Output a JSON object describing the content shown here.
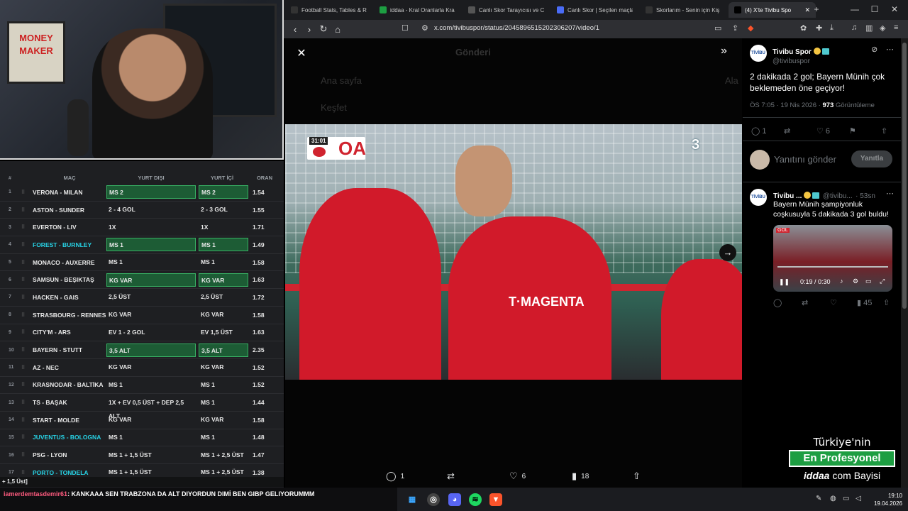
{
  "browser": {
    "tabs": [
      {
        "label": "Football Stats, Tables & R",
        "icon": "football-icon",
        "active": false
      },
      {
        "label": "iddaa - Kral Oranlarla Kra",
        "icon": "iddaa-icon",
        "active": false
      },
      {
        "label": "Canlı Skor Tarayıcısı ve C",
        "icon": "score-icon",
        "active": false
      },
      {
        "label": "Canlı Skor | Seçilen maçla",
        "icon": "canli-skor-icon",
        "active": false
      },
      {
        "label": "Skorlarım - Senin için Kiş",
        "icon": "skorlarim-icon",
        "active": false
      },
      {
        "label": "(4) X'te Tivibu Spo",
        "icon": "x-icon",
        "active": true
      }
    ],
    "url": "x.com/tivibuspor/status/2045896515202306207/video/1"
  },
  "sheet": {
    "headers": {
      "num": "#",
      "mac": "MAÇ",
      "yurt_disi": "YURT DIŞI",
      "yurt_ici": "YURT İÇİ",
      "oran": "ORAN"
    },
    "rows": [
      {
        "n": "1",
        "mac": "VERONA - MILAN",
        "dis": "MS 2",
        "ici": "MS 2",
        "oran": "1.54",
        "hl": true,
        "cy": false
      },
      {
        "n": "2",
        "mac": "ASTON - SUNDER",
        "dis": "2 - 4 GOL",
        "ici": "2 - 3 GOL",
        "oran": "1.55",
        "hl": false,
        "cy": false
      },
      {
        "n": "3",
        "mac": "EVERTON - LIV",
        "dis": "1X",
        "ici": "1X",
        "oran": "1.71",
        "hl": false,
        "cy": false
      },
      {
        "n": "4",
        "mac": "FOREST - BURNLEY",
        "dis": "MS 1",
        "ici": "MS 1",
        "oran": "1.49",
        "hl": true,
        "cy": true
      },
      {
        "n": "5",
        "mac": "MONACO - AUXERRE",
        "dis": "MS 1",
        "ici": "MS 1",
        "oran": "1.58",
        "hl": false,
        "cy": false
      },
      {
        "n": "6",
        "mac": "SAMSUN - BEŞIKTAŞ",
        "dis": "KG VAR",
        "ici": "KG VAR",
        "oran": "1.63",
        "hl": true,
        "cy": false
      },
      {
        "n": "7",
        "mac": "HACKEN - GAIS",
        "dis": "2,5 ÜST",
        "ici": "2,5 ÜST",
        "oran": "1.72",
        "hl": false,
        "cy": false
      },
      {
        "n": "8",
        "mac": "STRASBOURG - RENNES",
        "dis": "KG VAR",
        "ici": "KG VAR",
        "oran": "1.58",
        "hl": false,
        "cy": false
      },
      {
        "n": "9",
        "mac": "CITY'M - ARS",
        "dis": "EV 1 - 2 GOL",
        "ici": "EV 1,5 ÜST",
        "oran": "1.63",
        "hl": false,
        "cy": false
      },
      {
        "n": "10",
        "mac": "BAYERN - STUTT",
        "dis": "3,5 ALT",
        "ici": "3,5 ALT",
        "oran": "2.35",
        "hl": true,
        "cy": false
      },
      {
        "n": "11",
        "mac": "AZ - NEC",
        "dis": "KG VAR",
        "ici": "KG VAR",
        "oran": "1.52",
        "hl": false,
        "cy": false
      },
      {
        "n": "12",
        "mac": "KRASNODAR - BALTİKA",
        "dis": "MS 1",
        "ici": "MS 1",
        "oran": "1.52",
        "hl": false,
        "cy": false
      },
      {
        "n": "13",
        "mac": "TS - BAŞAK",
        "dis": "1X + EV 0,5 ÜST + DEP 2,5 ALT",
        "ici": "MS 1",
        "oran": "1.44",
        "hl": false,
        "cy": false
      },
      {
        "n": "14",
        "mac": "START - MOLDE",
        "dis": "KG VAR",
        "ici": "KG VAR",
        "oran": "1.58",
        "hl": false,
        "cy": false
      },
      {
        "n": "15",
        "mac": "JUVENTUS - BOLOGNA",
        "dis": "MS 1",
        "ici": "MS 1",
        "oran": "1.48",
        "hl": false,
        "cy": true
      },
      {
        "n": "16",
        "mac": "PSG - LYON",
        "dis": "MS 1 + 1,5 ÜST",
        "ici": "MS 1 + 2,5 ÜST",
        "oran": "1.47",
        "hl": false,
        "cy": false
      },
      {
        "n": "17",
        "mac": "PORTO - TONDELA",
        "dis": "MS 1 + 1,5 ÜST",
        "ici": "MS 1 + 2,5 ÜST",
        "oran": "1.38",
        "hl": false,
        "cy": true
      }
    ],
    "footer": "+ 1,5 Üst]"
  },
  "webcam": {
    "poster_text": "MONEY MAKER"
  },
  "chat": {
    "user": "iamerdemtasdemir61",
    "message": ": KANKAAA SEN TRABZONA DA ALT DIYORDUN DIMİ BEN GIBP GELIYORUMMM"
  },
  "viewer": {
    "ghost": {
      "header": "Gönderi",
      "nav1": "Ana sayfa",
      "nav2": "Keşfet",
      "side": "Ala"
    },
    "score_time": "31:01",
    "score_team": "OA",
    "channel": "3",
    "actions": {
      "replies": "1",
      "likes": "6",
      "views": "18"
    }
  },
  "tweet": {
    "name": "Tivibu Spor",
    "handle": "@tivibuspor",
    "text": "2 dakikada 2 gol; Bayern Münih çok beklemeden öne geçiyor!",
    "time": "ÖS 7:05 · 19 Nis 2026 · ",
    "views": "973",
    "views_label": " Görüntüleme",
    "replies": "1",
    "likes": "6"
  },
  "reply_box": {
    "placeholder": "Yanıtını gönder",
    "button": "Yanıtla"
  },
  "reply2": {
    "name": "Tivibu ...",
    "handle": "@tivibu...",
    "age": "· 53sn",
    "text": "Bayern Münih şampiyonluk coşkusuyla 5 dakikada 3 gol buldu!",
    "video_time": "0:19 / 0:30",
    "views": "45"
  },
  "ad": {
    "line1": "Türkiye'nin",
    "line2": "En Profesyonel",
    "brand": "iddaa",
    "brand_suffix": "com",
    "line3": "Bayisi"
  },
  "taskbar": {
    "time": "19:10",
    "date": "19.04.2026"
  },
  "colors": {
    "highlight_bg": "#1d5c35",
    "highlight_border": "#37b063",
    "cyan_text": "#27d3e6",
    "bayern_red": "#d0242f",
    "ad_green": "#1d9e42"
  }
}
